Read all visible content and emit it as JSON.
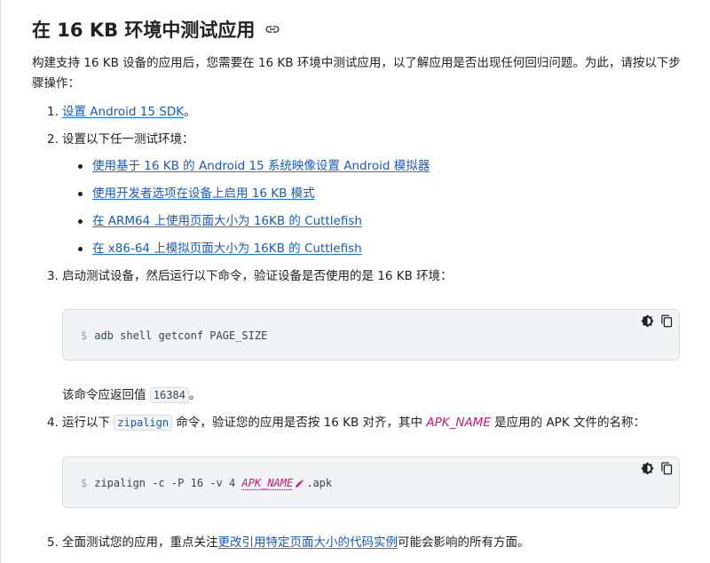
{
  "title": "在 16 KB 环境中测试应用",
  "intro": "构建支持 16 KB 设备的应用后，您需要在 16 KB 环境中测试应用，以了解应用是否出现任何回归问题。为此，请按以下步骤操作：",
  "steps": [
    {
      "num": "1.",
      "link": "设置 Android 15 SDK",
      "suffix": "。"
    },
    {
      "num": "2.",
      "text": "设置以下任一测试环境：",
      "bullets": [
        "使用基于 16 KB 的 Android 15 系统映像设置 Android 模拟器",
        "使用开发者选项在设备上启用 16 KB 模式",
        "在 ARM64 上使用页面大小为 16KB 的 Cuttlefish",
        "在 x86-64 上模拟页面大小为 16KB 的 Cuttlefish"
      ]
    },
    {
      "num": "3.",
      "text": "启动测试设备，然后运行以下命令，验证设备是否使用的是 16 KB 环境：",
      "code_prompt": "$",
      "code": "adb shell getconf PAGE_SIZE",
      "result_prefix": "该命令应返回值",
      "result_value": "16384",
      "result_suffix": "。"
    },
    {
      "num": "4.",
      "text_a": "运行以下",
      "inline_code": "zipalign",
      "text_b": "命令，验证您的应用是否按 16 KB 对齐，其中",
      "var": "APK_NAME",
      "text_c": "是应用的 APK 文件的名称：",
      "code_prompt": "$",
      "code_a": "zipalign -c -P 16 -v 4",
      "code_var": "APK_NAME",
      "code_b": ".apk"
    },
    {
      "num": "5.",
      "text_a": "全面测试您的应用，重点关注",
      "link": "更改引用特定页面大小的代码实例",
      "text_b": "可能会影响的所有方面。"
    }
  ],
  "icons": {
    "anchor": "link-icon",
    "theme": "dark-mode-icon",
    "copy": "copy-icon",
    "edit": "pencil-icon"
  },
  "colors": {
    "link": "#1a73e8",
    "var": "#c5197d",
    "code_bg": "#f1f3f4"
  }
}
